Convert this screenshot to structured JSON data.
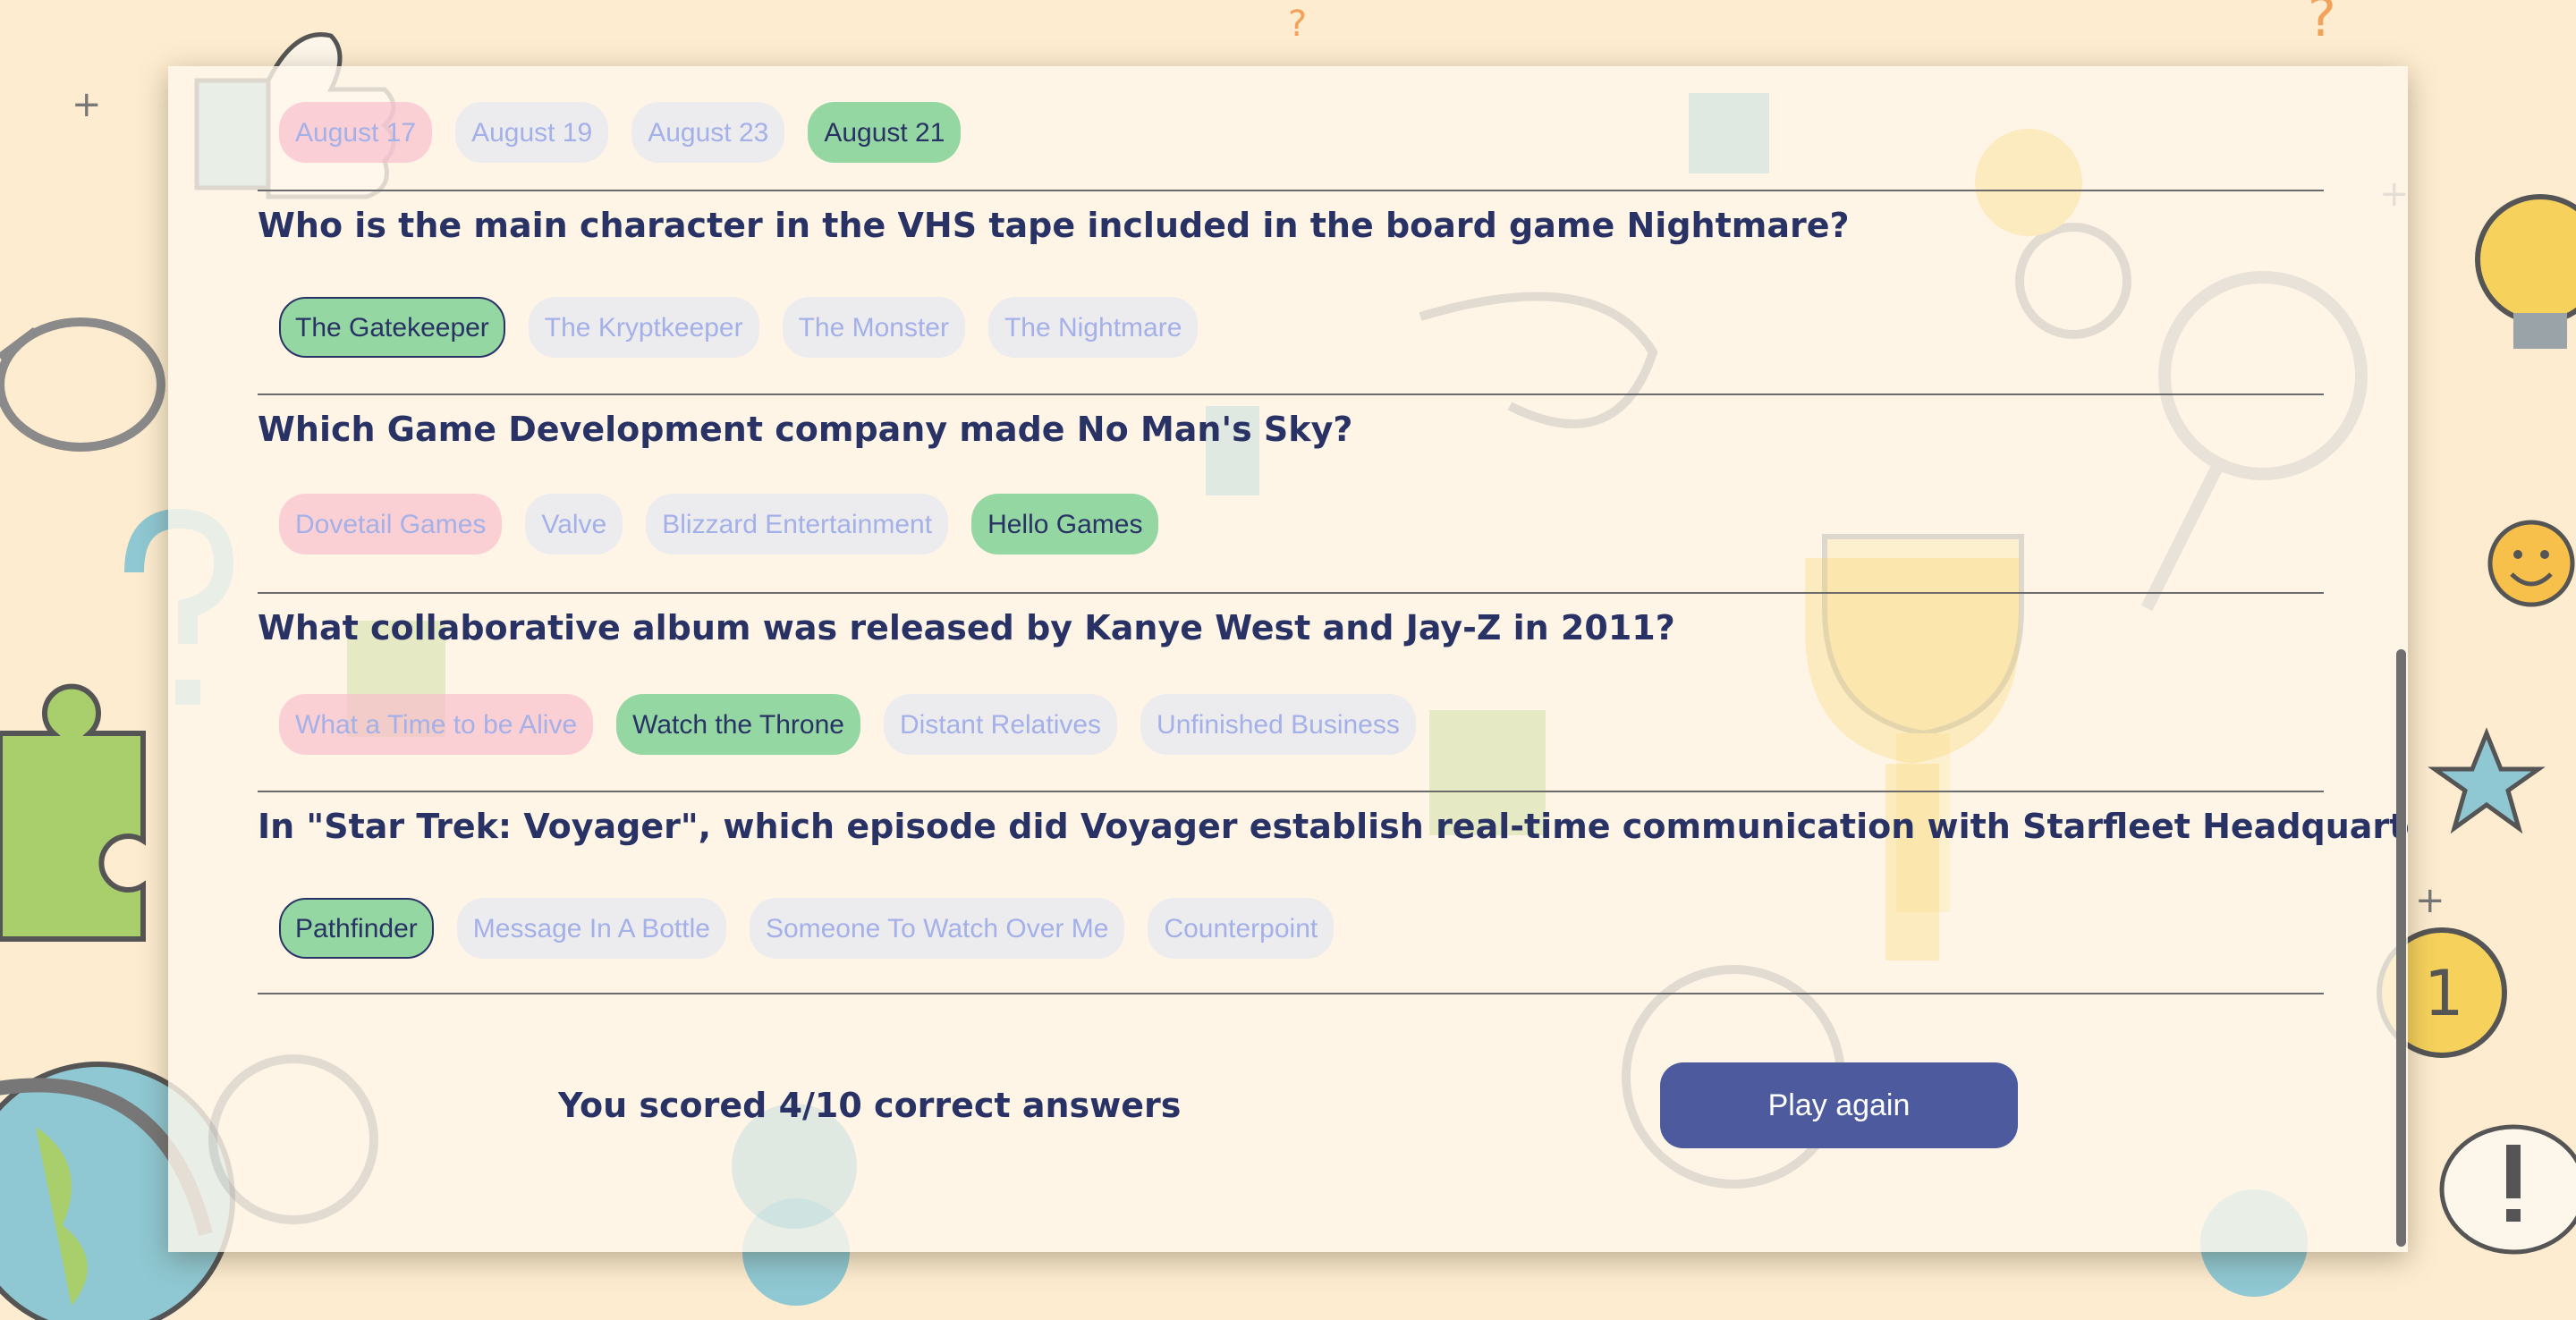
{
  "colors": {
    "background": "#fdeccf",
    "text": "#293264",
    "correct": "#94d7a2",
    "wrong": "#f8bccb",
    "button": "#4d5b9e"
  },
  "questions": [
    {
      "title": "",
      "answers": [
        {
          "label": "August 17",
          "state": "wrong",
          "picked": false
        },
        {
          "label": "August 19",
          "state": "neutral",
          "picked": false
        },
        {
          "label": "August 23",
          "state": "neutral",
          "picked": false
        },
        {
          "label": "August 21",
          "state": "correct",
          "picked": false
        }
      ]
    },
    {
      "title": "Who is the main character in the VHS tape included in the board game Nightmare?",
      "answers": [
        {
          "label": "The Gatekeeper",
          "state": "correct",
          "picked": true
        },
        {
          "label": "The Kryptkeeper",
          "state": "neutral",
          "picked": false
        },
        {
          "label": "The Monster",
          "state": "neutral",
          "picked": false
        },
        {
          "label": "The Nightmare",
          "state": "neutral",
          "picked": false
        }
      ]
    },
    {
      "title": "Which Game Development company made No Man's Sky?",
      "answers": [
        {
          "label": "Dovetail Games",
          "state": "wrong",
          "picked": false
        },
        {
          "label": "Valve",
          "state": "neutral",
          "picked": false
        },
        {
          "label": "Blizzard Entertainment",
          "state": "neutral",
          "picked": false
        },
        {
          "label": "Hello Games",
          "state": "correct",
          "picked": false
        }
      ]
    },
    {
      "title": "What collaborative album was released by Kanye West and Jay-Z in 2011?",
      "answers": [
        {
          "label": "What a Time to be Alive",
          "state": "wrong",
          "picked": false
        },
        {
          "label": "Watch the Throne",
          "state": "correct",
          "picked": false
        },
        {
          "label": "Distant Relatives",
          "state": "neutral",
          "picked": false
        },
        {
          "label": "Unfinished Business",
          "state": "neutral",
          "picked": false
        }
      ]
    },
    {
      "title": "In \"Star Trek: Voyager\", which episode did Voyager establish real-time communication with Starfleet Headquarters?",
      "answers": [
        {
          "label": "Pathfinder",
          "state": "correct",
          "picked": true
        },
        {
          "label": "Message In A Bottle",
          "state": "neutral",
          "picked": false
        },
        {
          "label": "Someone To Watch Over Me",
          "state": "neutral",
          "picked": false
        },
        {
          "label": "Counterpoint",
          "state": "neutral",
          "picked": false
        }
      ]
    }
  ],
  "footer": {
    "score_text": "You scored 4/10 correct answers",
    "play_again_label": "Play again"
  },
  "background_icons": [
    "thumbs-up-icon",
    "trophy-icon",
    "magnifier-icon",
    "glasses-icon",
    "lightbulb-icon",
    "medal-icon",
    "puzzle-icon",
    "globe-icon",
    "envelope-icon",
    "gear-icon",
    "question-mark-icon",
    "exclamation-icon",
    "smiley-icon",
    "star-icon",
    "pencil-icon",
    "play-button-icon"
  ]
}
